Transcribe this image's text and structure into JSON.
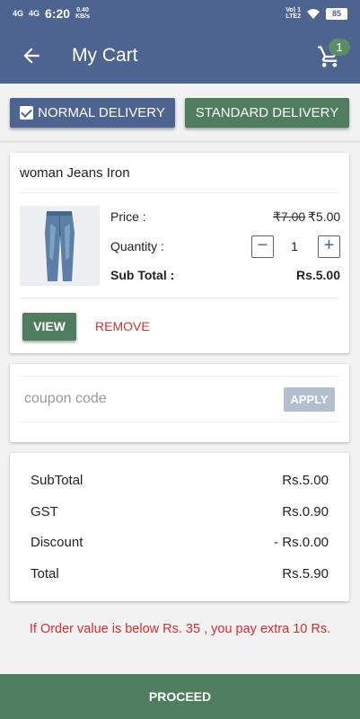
{
  "status_bar": {
    "signal1": "4G",
    "signal2": "4G",
    "time": "6:20",
    "speed_value": "0.40",
    "speed_unit": "KB/s",
    "volte": "Vo) 1",
    "lte": "LTE2",
    "battery": "85"
  },
  "app_bar": {
    "title": "My Cart",
    "cart_count": "1"
  },
  "delivery": {
    "normal_label": "NORMAL DELIVERY",
    "standard_label": "STANDARD DELIVERY",
    "normal_selected": true
  },
  "product": {
    "name": "woman Jeans Iron",
    "price_label": "Price :",
    "old_price": "₹7.00",
    "new_price": "₹5.00",
    "quantity_label": "Quantity :",
    "quantity": "1",
    "subtotal_label": "Sub Total :",
    "subtotal_value": "Rs.5.00",
    "view_label": "VIEW",
    "remove_label": "REMOVE"
  },
  "coupon": {
    "placeholder": "coupon code",
    "apply_label": "APPLY"
  },
  "summary": {
    "rows": [
      {
        "label": "SubTotal",
        "value": "Rs.5.00"
      },
      {
        "label": "GST",
        "value": "Rs.0.90"
      },
      {
        "label": "Discount",
        "value": "- Rs.0.00"
      },
      {
        "label": "Total",
        "value": "Rs.5.90"
      }
    ]
  },
  "note": "If Order value is below Rs. 35 , you pay extra 10 Rs.",
  "proceed_label": "PROCEED",
  "colors": {
    "primary": "#4e6490",
    "accent_green": "#4f7d5e",
    "warning_red": "#d32f2f",
    "apply_disabled": "#b2bfd0"
  },
  "icons": {
    "back": "arrow-left",
    "cart": "shopping-cart",
    "minus": "minus-box",
    "plus": "plus-box",
    "wifi": "wifi",
    "checkbox": "checkbox-checked"
  }
}
